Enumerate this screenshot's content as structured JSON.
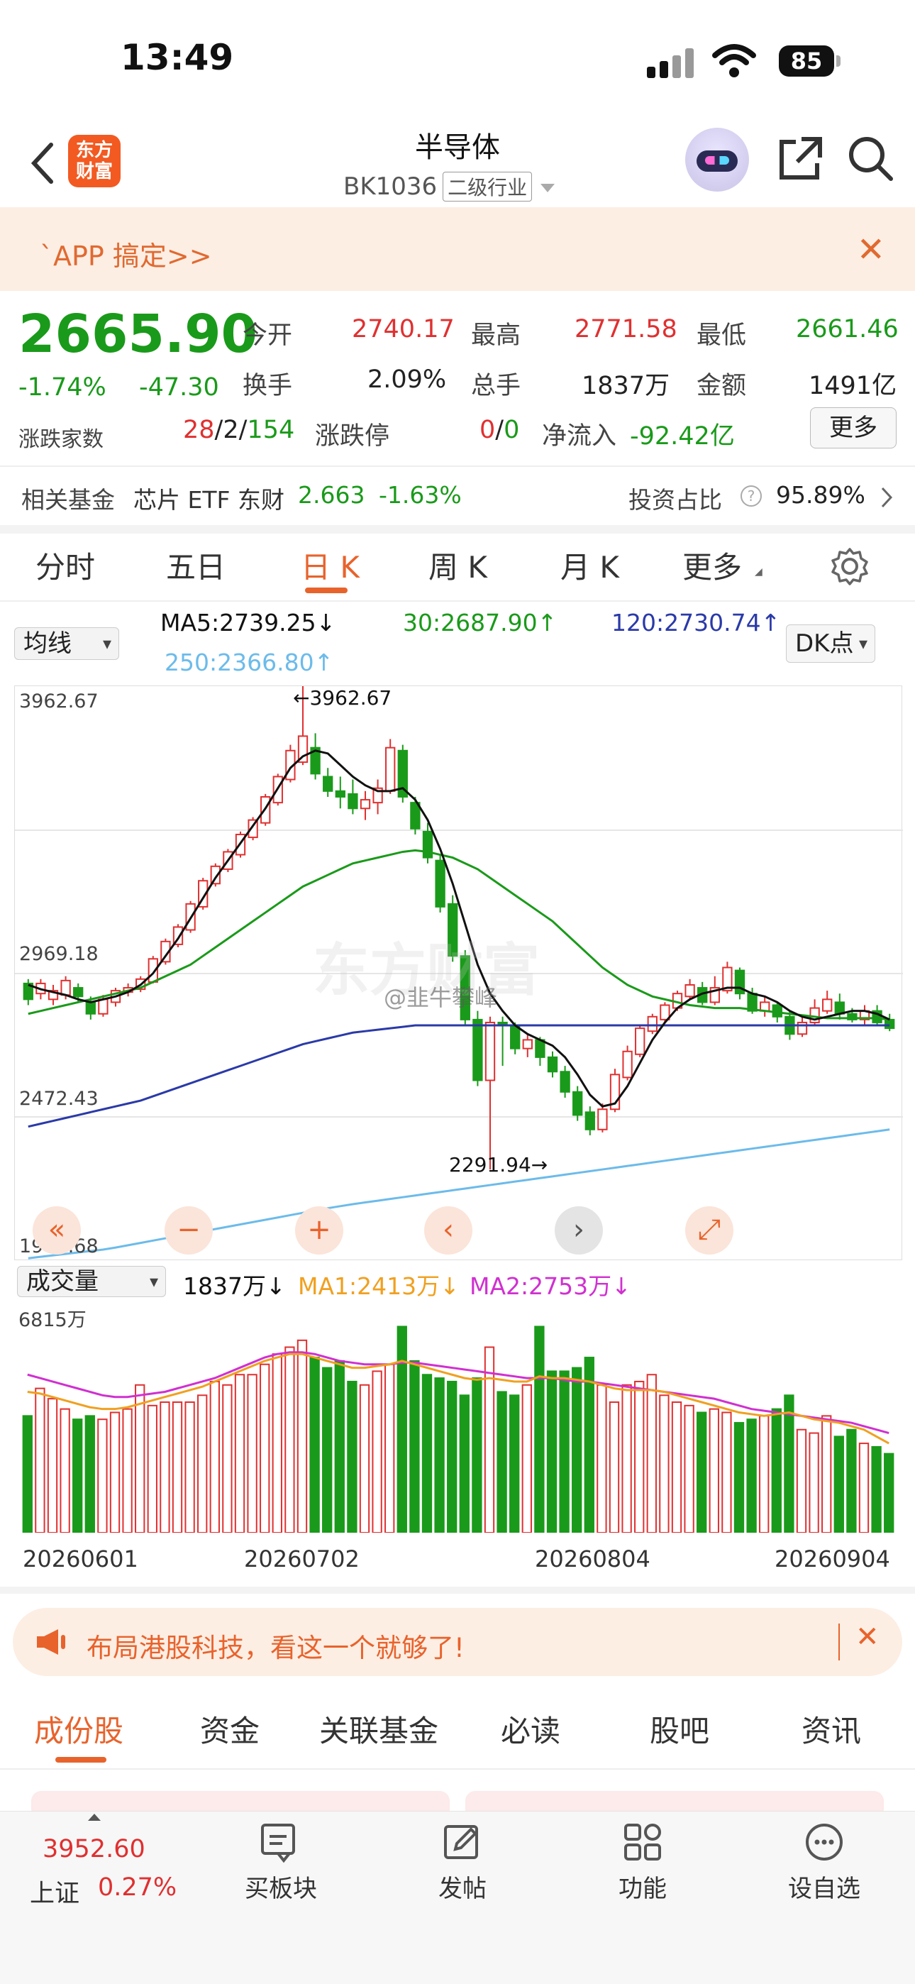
{
  "status": {
    "time": "13:49",
    "battery": "85"
  },
  "header": {
    "logo_line1": "东方",
    "logo_line2": "财富",
    "title": "半导体",
    "code": "BK1036",
    "tag": "二级行业"
  },
  "promo": {
    "text": "`APP 搞定>>"
  },
  "quote": {
    "price": "2665.90",
    "change_pct": "-1.74%",
    "change_amt": "-47.30",
    "open_label": "今开",
    "open": "2740.17",
    "high_label": "最高",
    "high": "2771.58",
    "low_label": "最低",
    "low": "2661.46",
    "turnover_label": "换手",
    "turnover": "2.09%",
    "volume_label": "总手",
    "volume": "1837万",
    "amount_label": "金额",
    "amount": "1491亿",
    "breadth_label": "涨跌家数",
    "up": "28",
    "flat": "2",
    "down": "154",
    "limit_label": "涨跌停",
    "limit_up": "0",
    "limit_down": "0",
    "netflow_label": "净流入",
    "netflow": "-92.42亿",
    "more": "更多"
  },
  "fund": {
    "label": "相关基金",
    "name": "芯片 ETF 东财",
    "price": "2.663",
    "pct": "-1.63%",
    "ratio_label": "投资占比",
    "ratio": "95.89%"
  },
  "chart_tabs": [
    "分时",
    "五日",
    "日 K",
    "周 K",
    "月 K",
    "更多"
  ],
  "ma": {
    "selector": "均线",
    "ma5": "MA5:2739.25↓",
    "ma30": "30:2687.90↑",
    "ma120": "120:2730.74↑",
    "ma250": "250:2366.80↑",
    "dk": "DK点"
  },
  "axis": {
    "y1": "3962.67",
    "y2": "2969.18",
    "y3": "2472.43",
    "y4": "1975.68",
    "max_label": "←3962.67",
    "min_label": "2291.94→",
    "vol_max": "6815万"
  },
  "watermark": "东方财富",
  "weibo_mark": "@韭牛攀峰",
  "volume": {
    "selector": "成交量",
    "value": "1837万↓",
    "ma1": "MA1:2413万↓",
    "ma2": "MA2:2753万↓"
  },
  "dates": [
    "20260601",
    "20260702",
    "20260804",
    "20260904"
  ],
  "colors": {
    "up": "#e03030",
    "down": "#1a9a1a",
    "ma5": "#111111",
    "ma30": "#1a9a1a",
    "ma120": "#2a3aa8",
    "ma250": "#6cbbea",
    "vma1": "#f0a020",
    "vma2": "#d030d0",
    "accent": "#e8632c"
  },
  "chart_data": {
    "type": "candlestick",
    "ylim": [
      1975.68,
      3962.67
    ],
    "annotations": {
      "max": 3962.67,
      "min": 2291.94
    },
    "candles": [
      [
        2935,
        2880,
        2950,
        2860
      ],
      [
        2900,
        2935,
        2950,
        2880
      ],
      [
        2880,
        2910,
        2930,
        2860
      ],
      [
        2895,
        2945,
        2960,
        2880
      ],
      [
        2920,
        2890,
        2935,
        2870
      ],
      [
        2870,
        2830,
        2890,
        2810
      ],
      [
        2830,
        2880,
        2895,
        2820
      ],
      [
        2870,
        2910,
        2920,
        2855
      ],
      [
        2905,
        2920,
        2935,
        2890
      ],
      [
        2915,
        2950,
        2960,
        2905
      ],
      [
        2940,
        3020,
        3030,
        2935
      ],
      [
        3010,
        3080,
        3090,
        3000
      ],
      [
        3070,
        3130,
        3140,
        3060
      ],
      [
        3120,
        3210,
        3220,
        3110
      ],
      [
        3200,
        3290,
        3300,
        3190
      ],
      [
        3280,
        3340,
        3350,
        3270
      ],
      [
        3330,
        3390,
        3400,
        3320
      ],
      [
        3380,
        3450,
        3460,
        3370
      ],
      [
        3440,
        3500,
        3510,
        3430
      ],
      [
        3490,
        3580,
        3590,
        3480
      ],
      [
        3560,
        3650,
        3660,
        3550
      ],
      [
        3640,
        3740,
        3760,
        3630
      ],
      [
        3700,
        3790,
        3962.67,
        3690
      ],
      [
        3750,
        3660,
        3800,
        3640
      ],
      [
        3650,
        3600,
        3680,
        3580
      ],
      [
        3600,
        3580,
        3650,
        3540
      ],
      [
        3590,
        3540,
        3640,
        3520
      ],
      [
        3540,
        3570,
        3600,
        3500
      ],
      [
        3560,
        3610,
        3640,
        3520
      ],
      [
        3600,
        3750,
        3780,
        3590
      ],
      [
        3740,
        3580,
        3760,
        3560
      ],
      [
        3560,
        3470,
        3580,
        3450
      ],
      [
        3460,
        3370,
        3490,
        3350
      ],
      [
        3360,
        3200,
        3380,
        3180
      ],
      [
        3210,
        3030,
        3240,
        3010
      ],
      [
        3030,
        2810,
        3050,
        2790
      ],
      [
        2810,
        2600,
        2840,
        2580
      ],
      [
        2600,
        2800,
        2820,
        2291.94
      ],
      [
        2800,
        2790,
        2820,
        2650
      ],
      [
        2790,
        2710,
        2800,
        2690
      ],
      [
        2710,
        2740,
        2760,
        2680
      ],
      [
        2740,
        2680,
        2750,
        2650
      ],
      [
        2680,
        2630,
        2700,
        2610
      ],
      [
        2630,
        2560,
        2650,
        2540
      ],
      [
        2560,
        2480,
        2580,
        2460
      ],
      [
        2490,
        2430,
        2510,
        2410
      ],
      [
        2430,
        2500,
        2520,
        2420
      ],
      [
        2500,
        2620,
        2640,
        2490
      ],
      [
        2610,
        2700,
        2720,
        2600
      ],
      [
        2690,
        2780,
        2790,
        2680
      ],
      [
        2770,
        2820,
        2830,
        2760
      ],
      [
        2810,
        2860,
        2870,
        2800
      ],
      [
        2850,
        2900,
        2910,
        2840
      ],
      [
        2890,
        2930,
        2950,
        2880
      ],
      [
        2920,
        2870,
        2940,
        2860
      ],
      [
        2870,
        2920,
        2960,
        2860
      ],
      [
        2910,
        2990,
        3010,
        2900
      ],
      [
        2980,
        2900,
        2990,
        2880
      ],
      [
        2900,
        2840,
        2920,
        2830
      ],
      [
        2840,
        2870,
        2890,
        2820
      ],
      [
        2860,
        2820,
        2870,
        2800
      ],
      [
        2820,
        2760,
        2840,
        2740
      ],
      [
        2760,
        2800,
        2820,
        2750
      ],
      [
        2800,
        2850,
        2880,
        2790
      ],
      [
        2840,
        2880,
        2910,
        2830
      ],
      [
        2870,
        2830,
        2900,
        2810
      ],
      [
        2830,
        2810,
        2850,
        2800
      ],
      [
        2810,
        2840,
        2860,
        2790
      ],
      [
        2840,
        2800,
        2860,
        2790
      ],
      [
        2810,
        2780,
        2830,
        2770
      ]
    ],
    "ma5": [
      2930,
      2915,
      2905,
      2895,
      2880,
      2870,
      2880,
      2890,
      2905,
      2930,
      2970,
      3030,
      3090,
      3160,
      3230,
      3300,
      3360,
      3420,
      3480,
      3540,
      3610,
      3680,
      3720,
      3740,
      3730,
      3690,
      3650,
      3620,
      3600,
      3600,
      3610,
      3570,
      3500,
      3400,
      3280,
      3140,
      3000,
      2900,
      2840,
      2790,
      2760,
      2740,
      2720,
      2680,
      2620,
      2550,
      2510,
      2520,
      2580,
      2660,
      2740,
      2800,
      2850,
      2880,
      2900,
      2910,
      2920,
      2920,
      2900,
      2890,
      2870,
      2840,
      2820,
      2810,
      2820,
      2830,
      2840,
      2840,
      2830,
      2810
    ],
    "ma30": [
      2830,
      2840,
      2850,
      2860,
      2870,
      2880,
      2890,
      2900,
      2910,
      2920,
      2940,
      2960,
      2980,
      3000,
      3030,
      3060,
      3090,
      3120,
      3150,
      3180,
      3210,
      3240,
      3270,
      3290,
      3310,
      3330,
      3350,
      3360,
      3370,
      3380,
      3390,
      3395,
      3390,
      3380,
      3370,
      3350,
      3330,
      3300,
      3270,
      3240,
      3210,
      3180,
      3150,
      3110,
      3070,
      3030,
      2990,
      2960,
      2930,
      2910,
      2890,
      2880,
      2870,
      2860,
      2855,
      2850,
      2850,
      2850,
      2845,
      2840,
      2835,
      2830,
      2825,
      2820,
      2815,
      2815,
      2815,
      2815,
      2815,
      2810
    ],
    "ma120": [
      2440,
      2450,
      2460,
      2470,
      2480,
      2490,
      2500,
      2510,
      2520,
      2530,
      2545,
      2560,
      2575,
      2590,
      2605,
      2620,
      2635,
      2650,
      2665,
      2680,
      2695,
      2710,
      2725,
      2735,
      2745,
      2755,
      2765,
      2770,
      2775,
      2780,
      2785,
      2790,
      2790,
      2790,
      2790,
      2790,
      2790,
      2790,
      2790,
      2790,
      2790,
      2790,
      2790,
      2790,
      2790,
      2790,
      2790,
      2790,
      2790,
      2790,
      2790,
      2790,
      2790,
      2790,
      2790,
      2790,
      2790,
      2790,
      2790,
      2790,
      2790,
      2790,
      2790,
      2790,
      2790,
      2790,
      2790,
      2790,
      2790,
      2790
    ],
    "ma250": [
      1985,
      1990,
      1995,
      2000,
      2005,
      2010,
      2015,
      2022,
      2030,
      2038,
      2046,
      2054,
      2062,
      2070,
      2078,
      2086,
      2094,
      2102,
      2110,
      2118,
      2126,
      2134,
      2142,
      2150,
      2158,
      2165,
      2172,
      2178,
      2184,
      2190,
      2196,
      2202,
      2208,
      2214,
      2220,
      2226,
      2232,
      2238,
      2244,
      2250,
      2256,
      2262,
      2268,
      2274,
      2280,
      2286,
      2292,
      2298,
      2304,
      2310,
      2316,
      2322,
      2328,
      2334,
      2340,
      2346,
      2352,
      2358,
      2364,
      2370,
      2376,
      2382,
      2388,
      2394,
      2400,
      2406,
      2412,
      2418,
      2424,
      2430
    ],
    "volume_max": 6815,
    "volumes": [
      3400,
      4200,
      3900,
      3600,
      3300,
      3400,
      3300,
      3500,
      3600,
      4300,
      3700,
      3800,
      3800,
      3800,
      4000,
      4400,
      4300,
      4600,
      4600,
      4900,
      5200,
      5400,
      5600,
      5100,
      4800,
      5000,
      4400,
      4300,
      4700,
      4900,
      6000,
      5000,
      4600,
      4500,
      4400,
      4000,
      4500,
      5400,
      4100,
      4000,
      4300,
      6000,
      4700,
      4700,
      4800,
      5100,
      4300,
      3800,
      4300,
      4400,
      4600,
      4000,
      3800,
      3700,
      3500,
      3600,
      3500,
      3200,
      3300,
      3400,
      3600,
      4000,
      3000,
      2900,
      3400,
      2800,
      3000,
      2600,
      2500,
      2300
    ],
    "vma1": [
      4100,
      4050,
      3950,
      3850,
      3750,
      3650,
      3600,
      3600,
      3650,
      3750,
      3850,
      3950,
      4050,
      4150,
      4250,
      4400,
      4550,
      4700,
      4850,
      5000,
      5100,
      5200,
      5200,
      5100,
      5000,
      4900,
      4800,
      4800,
      4850,
      4900,
      5000,
      4900,
      4800,
      4700,
      4600,
      4500,
      4450,
      4500,
      4450,
      4400,
      4400,
      4550,
      4500,
      4500,
      4450,
      4400,
      4300,
      4200,
      4150,
      4150,
      4150,
      4100,
      4000,
      3900,
      3800,
      3700,
      3600,
      3500,
      3450,
      3400,
      3450,
      3500,
      3400,
      3300,
      3250,
      3200,
      3100,
      3000,
      2800,
      2600
    ],
    "vma2": [
      4600,
      4500,
      4400,
      4300,
      4200,
      4100,
      4000,
      3950,
      3950,
      4000,
      4050,
      4100,
      4200,
      4300,
      4400,
      4500,
      4650,
      4800,
      4950,
      5100,
      5200,
      5250,
      5250,
      5200,
      5100,
      5000,
      4950,
      4900,
      4900,
      4900,
      4950,
      4950,
      4900,
      4850,
      4800,
      4750,
      4700,
      4650,
      4600,
      4550,
      4500,
      4500,
      4500,
      4450,
      4400,
      4400,
      4350,
      4300,
      4250,
      4200,
      4150,
      4100,
      4050,
      4000,
      3950,
      3900,
      3800,
      3700,
      3600,
      3550,
      3500,
      3450,
      3400,
      3350,
      3300,
      3250,
      3200,
      3100,
      3000,
      2900
    ]
  },
  "notice": {
    "text": "布局港股科技，看这一个就够了!"
  },
  "bottom_tabs": [
    "成份股",
    "资金",
    "关联基金",
    "必读",
    "股吧",
    "资讯"
  ],
  "index": {
    "value": "3952.60",
    "name": "上证",
    "pct": "0.27%"
  },
  "toolbar": {
    "buy": "买板块",
    "post": "发帖",
    "func": "功能",
    "fav": "设自选"
  }
}
